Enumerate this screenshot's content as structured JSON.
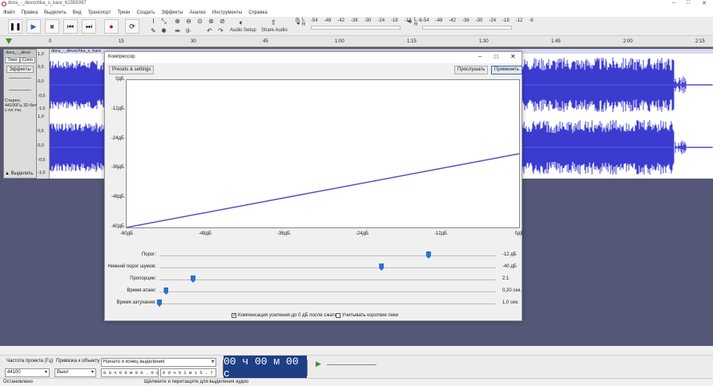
{
  "window": {
    "title": "dora_-_devochka_s_kare_61559397"
  },
  "menu": [
    "Файл",
    "Правка",
    "Выделить",
    "Вид",
    "Транспорт",
    "Треки",
    "Создать",
    "Эффекты",
    "Анализ",
    "Инструменты",
    "Справка"
  ],
  "toolbar": {
    "audio_setup": "Audio Setup",
    "share_audio": "Share Audio",
    "meter_rec_ch": "L R",
    "meter_play_ch": "L R",
    "meter_ticks": [
      "-54",
      "-48",
      "-42",
      "-36",
      "-30",
      "-24",
      "-18",
      "-12",
      "-6"
    ]
  },
  "ruler": {
    "ticks": [
      "0",
      "15",
      "30",
      "45",
      "1:00",
      "1:15",
      "1:30",
      "1:45",
      "2:00",
      "2:15"
    ]
  },
  "track": {
    "name": "dora_-_devo",
    "clip_name": "dora_-_devochka_s_kare",
    "mute": "Тихо",
    "solo": "Соло",
    "effects": "Эффекты",
    "info": "Стерео, 44100Гц 32-бит с пл.тчк.",
    "select": "Выделить",
    "scale": [
      "1,0",
      "0,5",
      "0,0",
      "-0,5",
      "-1,0",
      "1,0",
      "0,5",
      "0,0",
      "-0,5",
      "-1,0"
    ]
  },
  "dialog": {
    "title": "Компрессор",
    "presets": "Presets & settings",
    "preview": "Прослушать",
    "apply": "Применить",
    "y_labels": [
      "0дБ",
      "-12дБ",
      "-24дБ",
      "-36дБ",
      "-48дБ",
      "-60дБ"
    ],
    "x_labels": [
      "-60дБ",
      "-48дБ",
      "-36дБ",
      "-24дБ",
      "-12дБ",
      "0дБ"
    ],
    "sliders": [
      {
        "label": "Порог:",
        "value": "-12 дБ",
        "level": 0.8
      },
      {
        "label": "Нижний порог шумов:",
        "value": "-40 дБ",
        "level": 0.66
      },
      {
        "label": "Пропорции:",
        "value": "2:1",
        "level": 0.1
      },
      {
        "label": "Время атаки:",
        "value": "0,20 сек.",
        "level": 0.02
      },
      {
        "label": "Время затухания:",
        "value": "1,0 сек.",
        "level": 0.0
      }
    ],
    "makeup": "Компенсация усиления до 0 дБ после сжатия",
    "makeup_checked": true,
    "peaks": "Учитывать короткие пики",
    "peaks_checked": false
  },
  "chart_data": {
    "type": "line",
    "x": [
      -60,
      -12,
      0
    ],
    "y": [
      -60,
      -36,
      -30
    ],
    "xlim": [
      -60,
      0
    ],
    "ylim": [
      -60,
      0
    ]
  },
  "selection": {
    "rate_label": "Частота проекта (Гц)",
    "rate_value": "44100",
    "snap_label": "Привязка к объекту",
    "snap_value": "Выкл",
    "sel_label": "Начало и конец выделения",
    "start": "0 0 ч 0 0 м 0 0 . 0 0 0 с",
    "end": "0 0 ч 0 2 м 1 5 . 7 9 с",
    "time": "00 ч 00 м 00 с"
  },
  "status": {
    "left": "Остановлено",
    "center": "Щёлкните и перетащите для выделения аудио"
  },
  "colors": {
    "wave": "#3b3bd0",
    "track_bg": "#545777",
    "curve": "#5a4ec9",
    "thumb": "#2b6fd6"
  }
}
